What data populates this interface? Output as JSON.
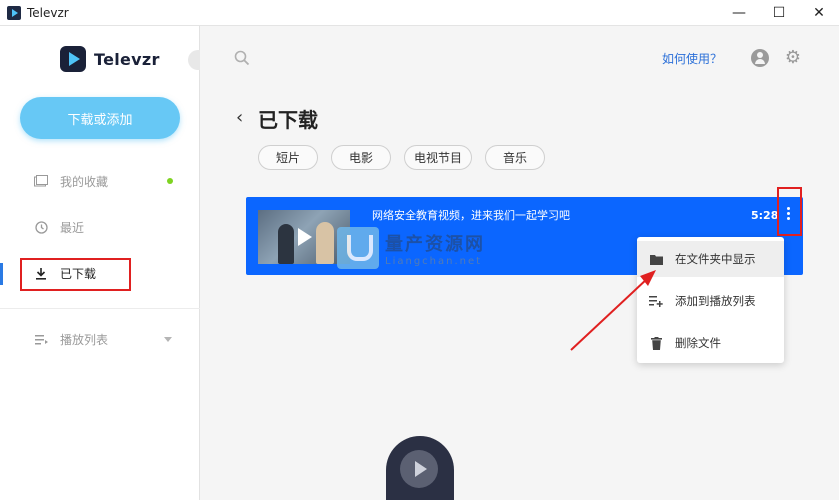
{
  "window": {
    "title": "Televzr",
    "minimize": "—",
    "maximize": "☐",
    "close": "✕"
  },
  "sidebar": {
    "brand": "Televzr",
    "download_button": "下载或添加",
    "items": [
      {
        "label": "我的收藏",
        "icon": "folder-icon"
      },
      {
        "label": "最近",
        "icon": "history-icon"
      },
      {
        "label": "已下载",
        "icon": "download-icon"
      },
      {
        "label": "播放列表",
        "icon": "playlist-icon"
      }
    ]
  },
  "header": {
    "search_icon": "search-icon",
    "help_link": "如何使用？",
    "user_icon": "user-icon",
    "gear_icon": "⚙"
  },
  "main": {
    "back": "‹",
    "title": "已下载",
    "chips": [
      "短片",
      "电影",
      "电视节目",
      "音乐"
    ],
    "video": {
      "title": "网络安全教育视频，进来我们一起学习吧",
      "duration": "5:28"
    },
    "watermark": {
      "cn": "量产资源网",
      "en": "Liangchan.net"
    },
    "context_menu": [
      {
        "label": "在文件夹中显示",
        "icon": "folder-open-icon"
      },
      {
        "label": "添加到播放列表",
        "icon": "playlist-add-icon"
      },
      {
        "label": "删除文件",
        "icon": "trash-icon"
      }
    ]
  },
  "colors": {
    "accent": "#67c8f5",
    "video_card": "#0b66ff",
    "highlight_box": "#e02020",
    "link": "#2a6fd8"
  }
}
